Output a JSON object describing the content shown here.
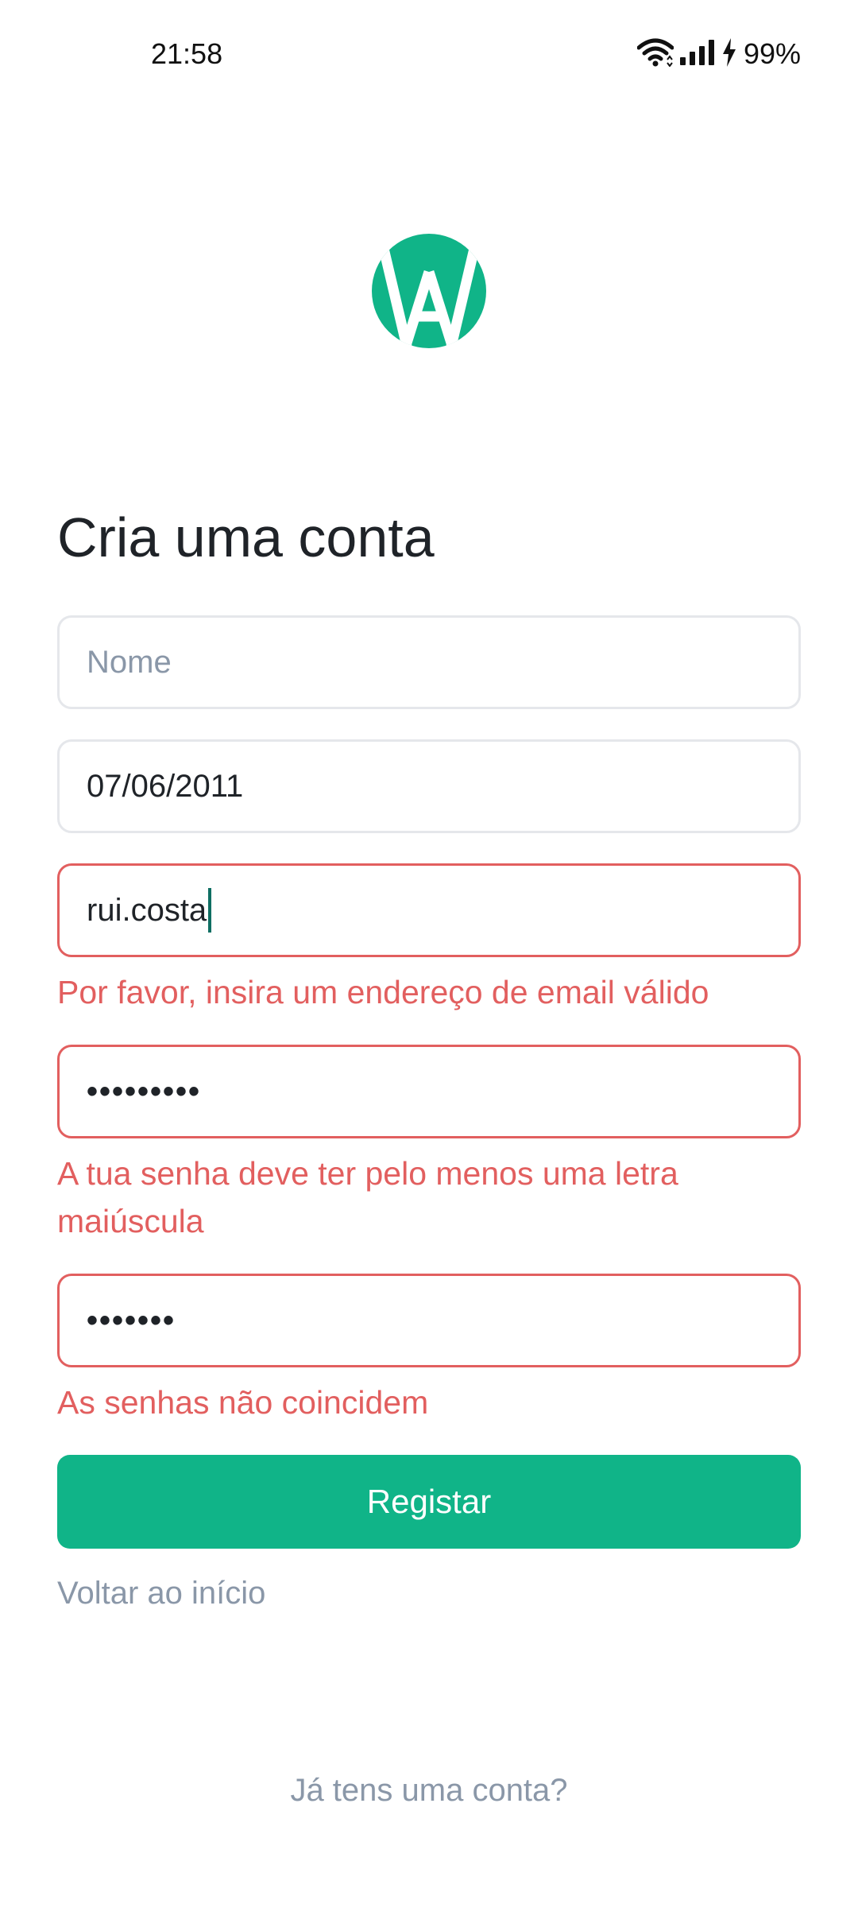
{
  "status_bar": {
    "time": "21:58",
    "battery": "99%",
    "icons": [
      "wifi-icon",
      "signal-icon",
      "charging-icon"
    ]
  },
  "logo": {
    "icon": "app-logo-icon",
    "color": "#10B488"
  },
  "page_title": "Cria uma conta",
  "form": {
    "name": {
      "placeholder": "Nome",
      "value": ""
    },
    "birthdate": {
      "value": "07/06/2011"
    },
    "email": {
      "value": "rui.costa",
      "error": "Por favor, insira um endereço de email válido"
    },
    "password": {
      "value": "•••••••••",
      "error": "A tua senha deve ter pelo menos uma letra maiúscula"
    },
    "confirm_password": {
      "value": "•••••••",
      "error": "As senhas não coincidem"
    },
    "submit_label": "Registar"
  },
  "links": {
    "back": "Voltar ao início",
    "login": "Já tens uma conta?"
  },
  "colors": {
    "accent": "#10B488",
    "error": "#E25F5F",
    "muted": "#8A97A8",
    "border": "#E5E7EB"
  }
}
